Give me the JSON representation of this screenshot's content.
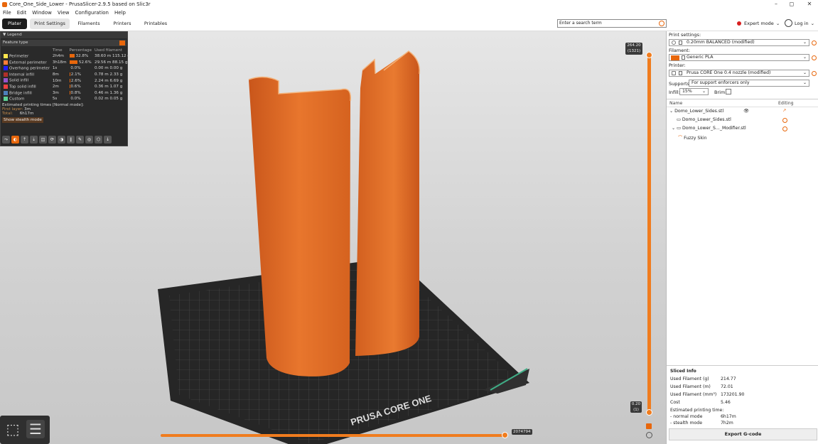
{
  "window": {
    "title": "Core_One_Side_Lower - PrusaSlicer-2.9.5 based on Slic3r",
    "controls": [
      "–",
      "◻",
      "✕"
    ]
  },
  "menu": [
    "File",
    "Edit",
    "Window",
    "View",
    "Configuration",
    "Help"
  ],
  "tabs": [
    "Plater",
    "Print Settings",
    "Filaments",
    "Printers",
    "Printables"
  ],
  "search": {
    "placeholder": "Enter a search term"
  },
  "mode": {
    "label": "Expert mode",
    "color": "#d81f1f"
  },
  "login": {
    "label": "Log in"
  },
  "legend": {
    "title": "Legend",
    "feature_type": "Feature type",
    "headers": [
      "Time",
      "Percentage",
      "Used filament"
    ],
    "rows": [
      {
        "name": "Perimeter",
        "time": "2h4m",
        "pct": "32.8%",
        "m": "38.60 m",
        "g": "115.12 g",
        "color": "#ffe64d",
        "fraction": 0.328
      },
      {
        "name": "External perimeter",
        "time": "3h18m",
        "pct": "52.6%",
        "m": "29.56 m",
        "g": "88.15 g",
        "color": "#ff7d38",
        "fraction": 0.526
      },
      {
        "name": "Overhang perimeter",
        "time": "1s",
        "pct": "0.0%",
        "m": "0.00 m",
        "g": "0.00 g",
        "color": "#1f1fff",
        "fraction": 0.0
      },
      {
        "name": "Internal infill",
        "time": "8m",
        "pct": "2.1%",
        "m": "0.78 m",
        "g": "2.33 g",
        "color": "#b03029",
        "fraction": 0.021
      },
      {
        "name": "Solid infill",
        "time": "10m",
        "pct": "2.6%",
        "m": "2.24 m",
        "g": "6.69 g",
        "color": "#9654cc",
        "fraction": 0.026
      },
      {
        "name": "Top solid infill",
        "time": "2m",
        "pct": "0.6%",
        "m": "0.36 m",
        "g": "1.07 g",
        "color": "#f04040",
        "fraction": 0.006
      },
      {
        "name": "Bridge infill",
        "time": "3m",
        "pct": "0.8%",
        "m": "0.46 m",
        "g": "1.36 g",
        "color": "#4d80ba",
        "fraction": 0.008
      },
      {
        "name": "Custom",
        "time": "5s",
        "pct": "0.0%",
        "m": "0.02 m",
        "g": "0.05 g",
        "color": "#5ed194",
        "fraction": 0.0
      }
    ],
    "estimated": "Estimated printing times [Normal mode]:",
    "first_layer_label": "First layer:",
    "first_layer": "3m",
    "total_label": "Total:",
    "total": "6h17m",
    "stealth_button": "Show stealth mode"
  },
  "slider": {
    "top_value": "264.20",
    "top_layer": "(1321)",
    "bottom_value": "0.20",
    "bottom_layer": "(1)",
    "horizontal_value": "2074794"
  },
  "bed_logo": "PRUSA CORE ONE",
  "sidebar": {
    "print_settings_label": "Print settings:",
    "print_settings": "0.20mm BALANCED (modified)",
    "filament_label": "Filament:",
    "filament": "Generic PLA",
    "filament_color": "#e8670c",
    "printer_label": "Printer:",
    "printer": "Prusa CORE One 0.4 nozzle (modified)",
    "supports_label": "Supports:",
    "supports": "For support enforcers only",
    "infill_label": "Infill:",
    "infill": "15%",
    "brim_label": "Brim:",
    "col_name": "Name",
    "col_editing": "Editing",
    "objects": [
      {
        "name": "Domo_Lower_Sides.stl"
      },
      {
        "name": "Domo_Lower_Sides.stl"
      },
      {
        "name": "Domo_Lower_S..._Modifier.stl"
      },
      {
        "name": "Fuzzy Skin"
      }
    ]
  },
  "sliced_info": {
    "title": "Sliced Info",
    "rows": [
      {
        "label": "Used Filament (g)",
        "value": "214.77"
      },
      {
        "label": "Used Filament (m)",
        "value": "72.01"
      },
      {
        "label": "Used Filament (mm³)",
        "value": "173201.90"
      },
      {
        "label": "Cost",
        "value": "5.46"
      }
    ],
    "est_label": "Estimated printing time:",
    "normal_label": "- normal mode",
    "normal": "6h17m",
    "stealth_label": "- stealth mode",
    "stealth": "7h2m"
  },
  "export_button": "Export G-code"
}
